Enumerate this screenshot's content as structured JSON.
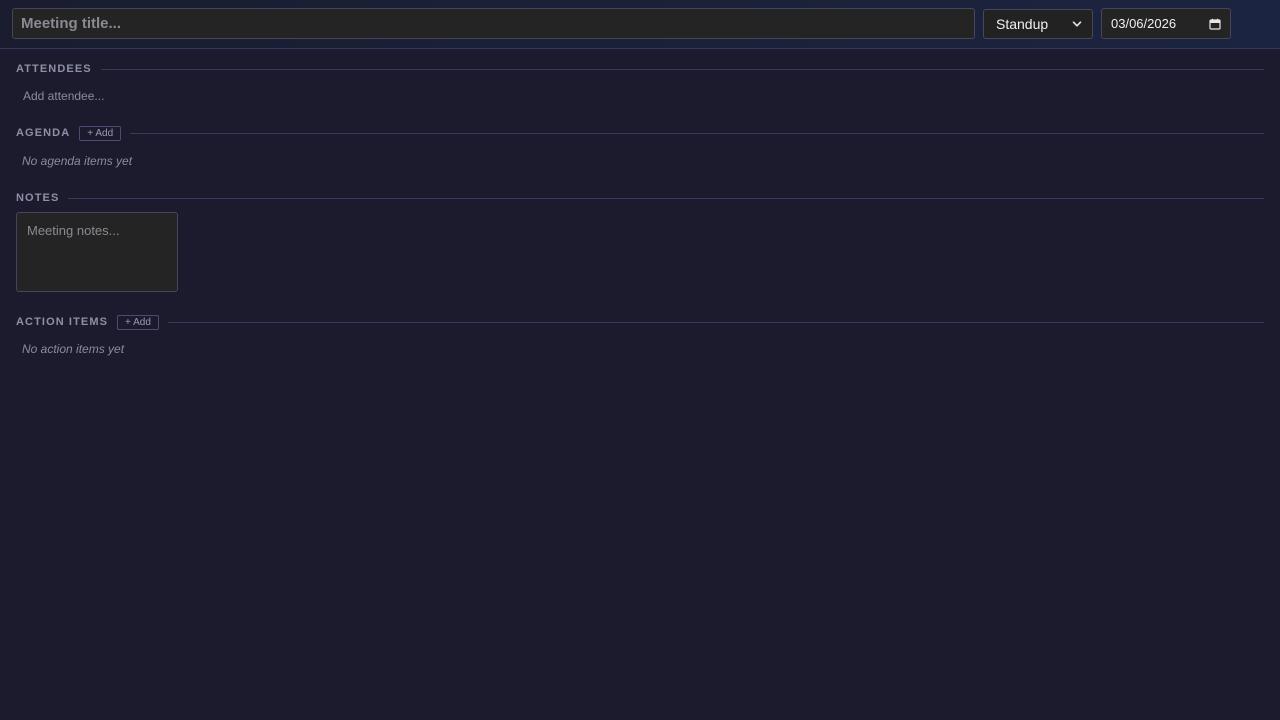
{
  "header": {
    "title_placeholder": "Meeting title...",
    "title_value": "",
    "meeting_type": "Standup",
    "date": "03/06/2026"
  },
  "sections": {
    "attendees": {
      "label": "ATTENDEES",
      "input_placeholder": "Add attendee..."
    },
    "agenda": {
      "label": "AGENDA",
      "add_label": "+ Add",
      "empty_text": "No agenda items yet"
    },
    "notes": {
      "label": "NOTES",
      "placeholder": "Meeting notes..."
    },
    "action_items": {
      "label": "ACTION ITEMS",
      "add_label": "+ Add",
      "empty_text": "No action items yet"
    }
  },
  "icons": {
    "select_chevron": "chevron-down-icon",
    "date_picker": "calendar-icon"
  },
  "colors": {
    "background": "#1b1b2d",
    "divider": "#37395e",
    "muted_text": "#8a8c9e"
  }
}
